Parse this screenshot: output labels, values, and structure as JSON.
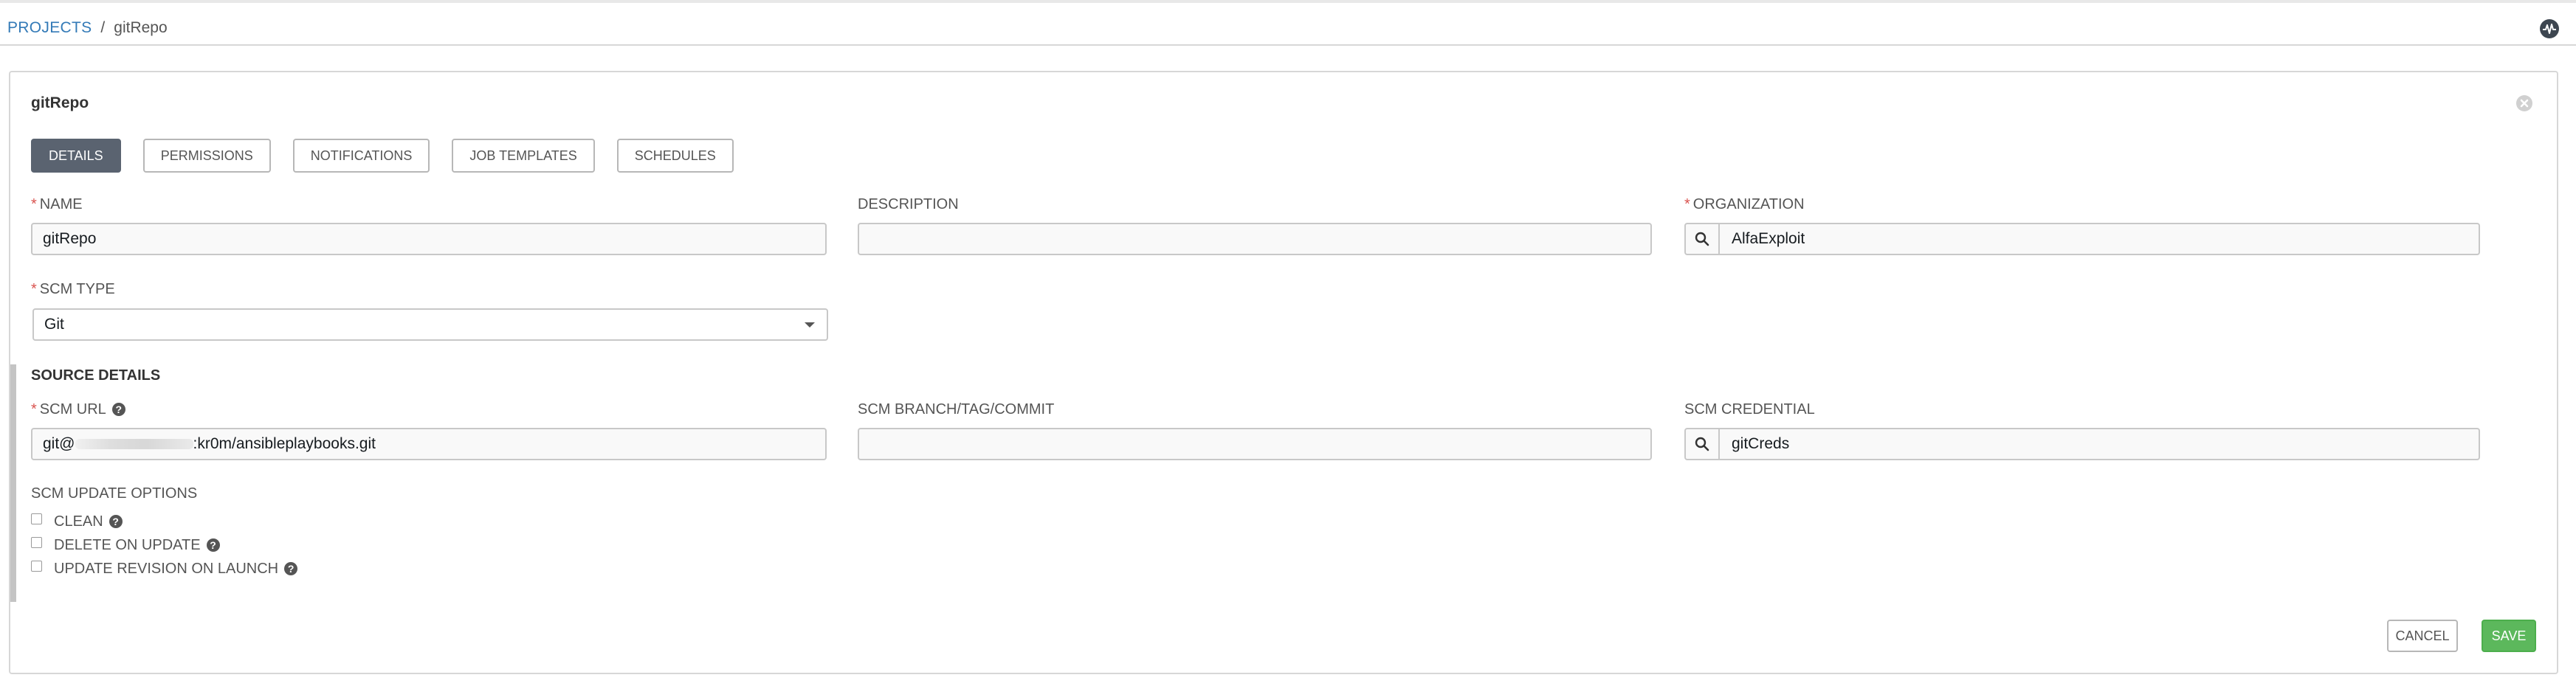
{
  "breadcrumb": {
    "parent": "PROJECTS",
    "separator": "/",
    "current": "gitRepo"
  },
  "card": {
    "title": "gitRepo"
  },
  "tabs": [
    {
      "label": "DETAILS",
      "active": true
    },
    {
      "label": "PERMISSIONS"
    },
    {
      "label": "NOTIFICATIONS"
    },
    {
      "label": "JOB TEMPLATES"
    },
    {
      "label": "SCHEDULES"
    }
  ],
  "fields": {
    "name": {
      "label": "NAME",
      "value": "gitRepo",
      "required": true
    },
    "description": {
      "label": "DESCRIPTION",
      "value": ""
    },
    "organization": {
      "label": "ORGANIZATION",
      "value": "AlfaExploit",
      "required": true
    },
    "scm_type": {
      "label": "SCM TYPE",
      "value": "Git",
      "required": true
    }
  },
  "source_details": {
    "title": "SOURCE DETAILS",
    "scm_url": {
      "label": "SCM URL",
      "value_prefix": "git@",
      "value_suffix": ":kr0m/ansibleplaybooks.git",
      "required": true
    },
    "scm_branch": {
      "label": "SCM BRANCH/TAG/COMMIT",
      "value": ""
    },
    "scm_credential": {
      "label": "SCM CREDENTIAL",
      "value": "gitCreds"
    },
    "update_options": {
      "title": "SCM UPDATE OPTIONS",
      "options": [
        {
          "label": "CLEAN",
          "checked": false
        },
        {
          "label": "DELETE ON UPDATE",
          "checked": false
        },
        {
          "label": "UPDATE REVISION ON LAUNCH",
          "checked": false
        }
      ]
    }
  },
  "actions": {
    "cancel": "CANCEL",
    "save": "SAVE"
  },
  "colors": {
    "accent_link": "#337ab7",
    "save": "#5cb85c",
    "required": "#d9534f",
    "active_tab": "#5a6370"
  },
  "icons": [
    "activity-stream-icon",
    "close-icon",
    "search-icon",
    "help-icon",
    "caret-down-icon"
  ]
}
